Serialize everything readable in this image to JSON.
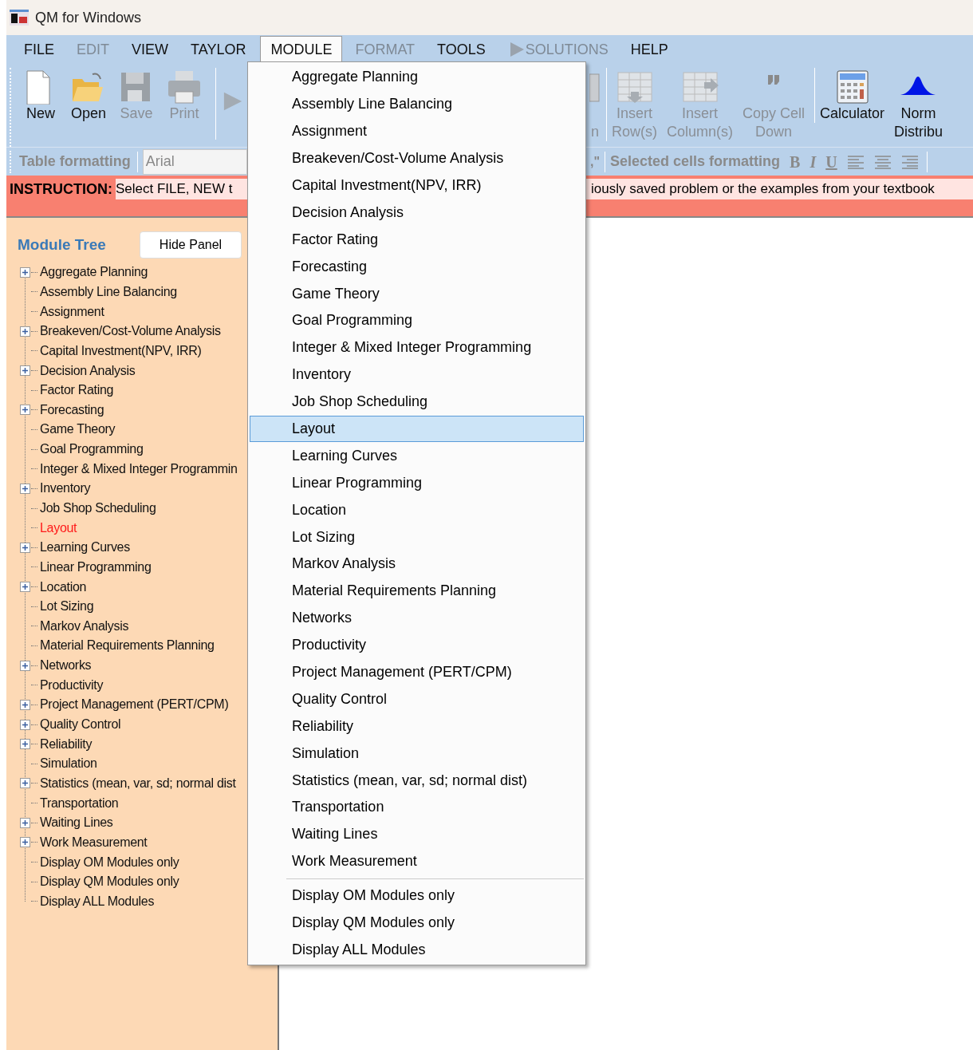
{
  "window": {
    "title": "QM for Windows"
  },
  "menu_bar": [
    {
      "label": "FILE",
      "disabled": false,
      "selected": false
    },
    {
      "label": "EDIT",
      "disabled": true,
      "selected": false
    },
    {
      "label": "VIEW",
      "disabled": false,
      "selected": false
    },
    {
      "label": "TAYLOR",
      "disabled": false,
      "selected": false
    },
    {
      "label": "MODULE",
      "disabled": false,
      "selected": true
    },
    {
      "label": "FORMAT",
      "disabled": true,
      "selected": false
    },
    {
      "label": "TOOLS",
      "disabled": false,
      "selected": false
    },
    {
      "label": "SOLUTIONS",
      "disabled": true,
      "selected": false,
      "kind": "play"
    },
    {
      "label": "HELP",
      "disabled": false,
      "selected": false
    }
  ],
  "toolbar_left": [
    {
      "kind": "new",
      "lines": [
        "New"
      ],
      "disabled": false
    },
    {
      "kind": "open",
      "lines": [
        "Open"
      ],
      "disabled": false
    },
    {
      "kind": "save",
      "lines": [
        "Save"
      ],
      "disabled": true
    },
    {
      "kind": "print",
      "lines": [
        "Print"
      ],
      "disabled": true
    },
    {
      "kind": "play",
      "disabled": true
    }
  ],
  "toolbar_right": [
    {
      "kind": "partial",
      "lines": [
        "n"
      ],
      "disabled": true
    },
    {
      "kind": "insert-row",
      "lines": [
        "Insert",
        "Row(s)"
      ],
      "disabled": true
    },
    {
      "kind": "insert-column",
      "lines": [
        "Insert",
        "Column(s)"
      ],
      "disabled": true
    },
    {
      "kind": "copy-down",
      "lines": [
        "Copy Cell",
        "Down"
      ],
      "disabled": true
    },
    {
      "kind": "calculator",
      "lines": [
        "Calculator"
      ],
      "disabled": false
    },
    {
      "kind": "normal",
      "lines": [
        "Norm",
        "Distribu"
      ],
      "disabled": false
    }
  ],
  "format_bar": {
    "label": "Table formatting",
    "font_field": "Arial",
    "partial_text": ",\"",
    "selected_label": "Selected cells formatting",
    "style_buttons": [
      "B",
      "I",
      "U"
    ]
  },
  "instruction": {
    "label": "INSTRUCTION:",
    "text_left": "Select FILE, NEW t",
    "text_right": "iously saved problem or the examples from your textbook"
  },
  "panel": {
    "title": "Module Tree",
    "hide_button": "Hide Panel",
    "tree": [
      {
        "label": "Aggregate Planning",
        "expandable": true,
        "selected": false
      },
      {
        "label": "Assembly Line Balancing",
        "expandable": false,
        "selected": false
      },
      {
        "label": "Assignment",
        "expandable": false,
        "selected": false
      },
      {
        "label": "Breakeven/Cost-Volume Analysis",
        "expandable": true,
        "selected": false
      },
      {
        "label": "Capital Investment(NPV, IRR)",
        "expandable": false,
        "selected": false
      },
      {
        "label": "Decision Analysis",
        "expandable": true,
        "selected": false
      },
      {
        "label": "Factor Rating",
        "expandable": false,
        "selected": false
      },
      {
        "label": "Forecasting",
        "expandable": true,
        "selected": false
      },
      {
        "label": "Game Theory",
        "expandable": false,
        "selected": false
      },
      {
        "label": "Goal Programming",
        "expandable": false,
        "selected": false
      },
      {
        "label": "Integer & Mixed Integer Programmin",
        "expandable": false,
        "selected": false
      },
      {
        "label": "Inventory",
        "expandable": true,
        "selected": false
      },
      {
        "label": "Job Shop Scheduling",
        "expandable": false,
        "selected": false
      },
      {
        "label": "Layout",
        "expandable": false,
        "selected": true
      },
      {
        "label": "Learning Curves",
        "expandable": true,
        "selected": false
      },
      {
        "label": "Linear Programming",
        "expandable": false,
        "selected": false
      },
      {
        "label": "Location",
        "expandable": true,
        "selected": false
      },
      {
        "label": "Lot Sizing",
        "expandable": false,
        "selected": false
      },
      {
        "label": "Markov Analysis",
        "expandable": false,
        "selected": false
      },
      {
        "label": "Material Requirements Planning",
        "expandable": false,
        "selected": false
      },
      {
        "label": "Networks",
        "expandable": true,
        "selected": false
      },
      {
        "label": "Productivity",
        "expandable": false,
        "selected": false
      },
      {
        "label": "Project Management (PERT/CPM)",
        "expandable": true,
        "selected": false
      },
      {
        "label": "Quality Control",
        "expandable": true,
        "selected": false
      },
      {
        "label": "Reliability",
        "expandable": true,
        "selected": false
      },
      {
        "label": "Simulation",
        "expandable": false,
        "selected": false
      },
      {
        "label": "Statistics (mean, var, sd; normal dist",
        "expandable": true,
        "selected": false
      },
      {
        "label": "Transportation",
        "expandable": false,
        "selected": false
      },
      {
        "label": "Waiting Lines",
        "expandable": true,
        "selected": false
      },
      {
        "label": "Work Measurement",
        "expandable": true,
        "selected": false
      },
      {
        "label": "Display OM Modules only",
        "expandable": false,
        "selected": false
      },
      {
        "label": "Display QM Modules only",
        "expandable": false,
        "selected": false
      },
      {
        "label": "Display ALL Modules",
        "expandable": false,
        "selected": false
      }
    ]
  },
  "module_menu": {
    "items": [
      {
        "label": "Aggregate Planning",
        "selected": false
      },
      {
        "label": "Assembly Line Balancing",
        "selected": false
      },
      {
        "label": "Assignment",
        "selected": false
      },
      {
        "label": "Breakeven/Cost-Volume Analysis",
        "selected": false
      },
      {
        "label": "Capital Investment(NPV, IRR)",
        "selected": false
      },
      {
        "label": "Decision Analysis",
        "selected": false
      },
      {
        "label": "Factor Rating",
        "selected": false
      },
      {
        "label": "Forecasting",
        "selected": false
      },
      {
        "label": "Game Theory",
        "selected": false
      },
      {
        "label": "Goal Programming",
        "selected": false
      },
      {
        "label": "Integer & Mixed Integer Programming",
        "selected": false
      },
      {
        "label": "Inventory",
        "selected": false
      },
      {
        "label": "Job Shop Scheduling",
        "selected": false
      },
      {
        "label": "Layout",
        "selected": true
      },
      {
        "label": "Learning Curves",
        "selected": false
      },
      {
        "label": "Linear Programming",
        "selected": false
      },
      {
        "label": "Location",
        "selected": false
      },
      {
        "label": "Lot Sizing",
        "selected": false
      },
      {
        "label": "Markov Analysis",
        "selected": false
      },
      {
        "label": "Material Requirements Planning",
        "selected": false
      },
      {
        "label": "Networks",
        "selected": false
      },
      {
        "label": "Productivity",
        "selected": false
      },
      {
        "label": "Project Management (PERT/CPM)",
        "selected": false
      },
      {
        "label": "Quality Control",
        "selected": false
      },
      {
        "label": "Reliability",
        "selected": false
      },
      {
        "label": "Simulation",
        "selected": false
      },
      {
        "label": "Statistics (mean, var, sd; normal dist)",
        "selected": false
      },
      {
        "label": "Transportation",
        "selected": false
      },
      {
        "label": "Waiting Lines",
        "selected": false
      },
      {
        "label": "Work Measurement",
        "selected": false
      }
    ],
    "display_items": [
      {
        "label": "Display OM Modules only",
        "selected": false
      },
      {
        "label": "Display QM Modules only",
        "selected": false
      },
      {
        "label": "Display ALL Modules",
        "selected": false
      }
    ]
  }
}
